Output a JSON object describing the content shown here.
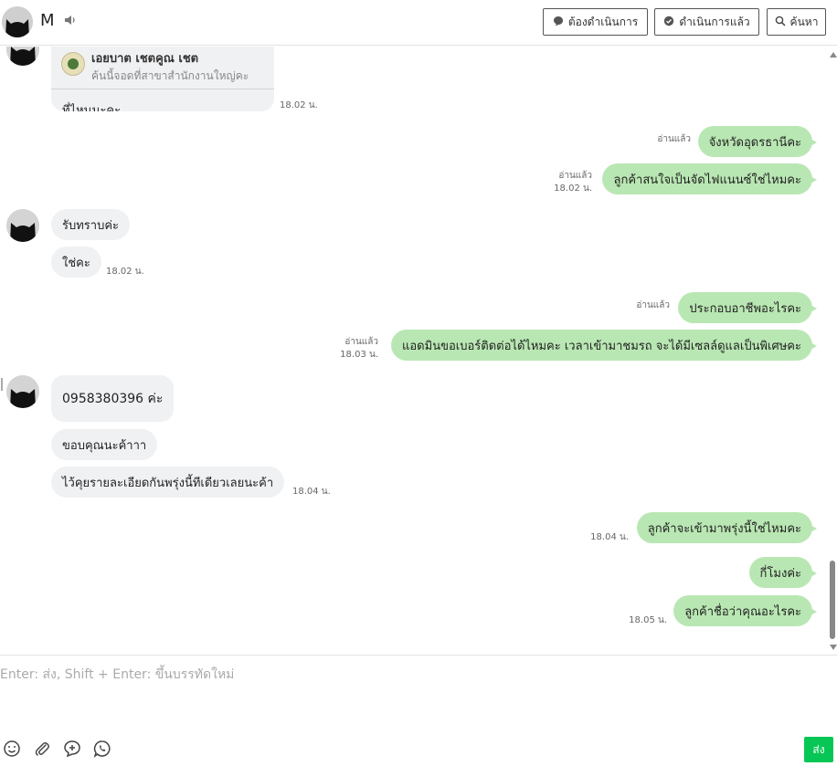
{
  "header": {
    "contact_name": "M",
    "buttons": {
      "todo": "ต้องดำเนินการ",
      "done": "ดำเนินการแล้ว",
      "search": "ค้นหา"
    }
  },
  "card": {
    "title": "เอยบาต เชตคูณ เชต",
    "subtitle": "ค้นนี้จอดที่สาขาสำนักงานใหญ่คะ",
    "message": "ที่ไหนนะคะ",
    "time": "18.02 น."
  },
  "messages": {
    "m1": {
      "text": "จังหวัดอุดรธานีคะ",
      "read": "อ่านแล้ว"
    },
    "m2": {
      "text": "ลูกค้าสนใจเป็นจัดไฟแนนซ์ใช่ไหมคะ",
      "read": "อ่านแล้ว",
      "time": "18.02 น."
    },
    "m3": {
      "text": "รับทราบค่ะ"
    },
    "m4": {
      "text": "ใช่คะ",
      "time": "18.02 น."
    },
    "m5": {
      "text": "ประกอบอาชีพอะไรคะ",
      "read": "อ่านแล้ว"
    },
    "m6": {
      "text": "แอดมินขอเบอร์ติดต่อได้ไหมคะ เวลาเข้ามาชมรถ จะได้มีเซลล์ดูแลเป็นพิเศษคะ",
      "read": "อ่านแล้ว",
      "time": "18.03 น."
    },
    "m7": {
      "text": "0958380396  ค่ะ"
    },
    "m8": {
      "text": "ขอบคุณนะค้าาา"
    },
    "m9": {
      "text": "ไว้คุยรายละเอียดกันพรุ่งนี้ทีเดียวเลยนะค้า",
      "time": "18.04 น."
    },
    "m10": {
      "text": "ลูกค้าจะเข้ามาพรุ่งนี้ใช่ไหมคะ",
      "time": "18.04 น."
    },
    "m11": {
      "text": "กี่โมงค่ะ"
    },
    "m12": {
      "text": "ลูกค้าชื่อว่าคุณอะไรคะ",
      "time": "18.05 น."
    }
  },
  "composer": {
    "placeholder": "Enter: ส่ง, Shift + Enter: ขึ้นบรรทัดใหม่",
    "send_label": "ส่ง"
  },
  "icons": [
    "speaker-icon",
    "chat-bubble-icon",
    "check-bubble-icon",
    "search-icon",
    "emoji-icon",
    "paperclip-icon",
    "add-chat-icon",
    "whatsapp-phone-icon"
  ]
}
